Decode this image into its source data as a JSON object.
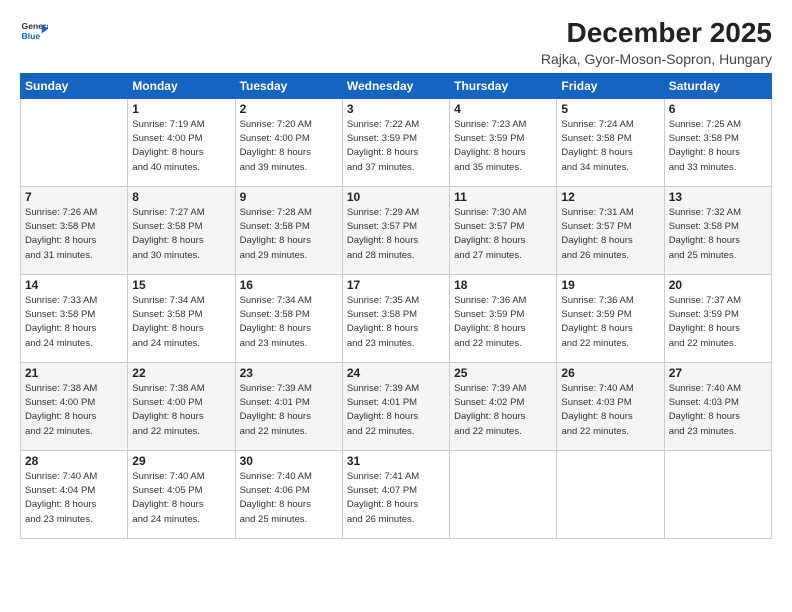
{
  "header": {
    "logo_line1": "General",
    "logo_line2": "Blue",
    "month": "December 2025",
    "location": "Rajka, Gyor-Moson-Sopron, Hungary"
  },
  "weekdays": [
    "Sunday",
    "Monday",
    "Tuesday",
    "Wednesday",
    "Thursday",
    "Friday",
    "Saturday"
  ],
  "weeks": [
    [
      {
        "day": "",
        "info": ""
      },
      {
        "day": "1",
        "info": "Sunrise: 7:19 AM\nSunset: 4:00 PM\nDaylight: 8 hours\nand 40 minutes."
      },
      {
        "day": "2",
        "info": "Sunrise: 7:20 AM\nSunset: 4:00 PM\nDaylight: 8 hours\nand 39 minutes."
      },
      {
        "day": "3",
        "info": "Sunrise: 7:22 AM\nSunset: 3:59 PM\nDaylight: 8 hours\nand 37 minutes."
      },
      {
        "day": "4",
        "info": "Sunrise: 7:23 AM\nSunset: 3:59 PM\nDaylight: 8 hours\nand 35 minutes."
      },
      {
        "day": "5",
        "info": "Sunrise: 7:24 AM\nSunset: 3:58 PM\nDaylight: 8 hours\nand 34 minutes."
      },
      {
        "day": "6",
        "info": "Sunrise: 7:25 AM\nSunset: 3:58 PM\nDaylight: 8 hours\nand 33 minutes."
      }
    ],
    [
      {
        "day": "7",
        "info": "Sunrise: 7:26 AM\nSunset: 3:58 PM\nDaylight: 8 hours\nand 31 minutes."
      },
      {
        "day": "8",
        "info": "Sunrise: 7:27 AM\nSunset: 3:58 PM\nDaylight: 8 hours\nand 30 minutes."
      },
      {
        "day": "9",
        "info": "Sunrise: 7:28 AM\nSunset: 3:58 PM\nDaylight: 8 hours\nand 29 minutes."
      },
      {
        "day": "10",
        "info": "Sunrise: 7:29 AM\nSunset: 3:57 PM\nDaylight: 8 hours\nand 28 minutes."
      },
      {
        "day": "11",
        "info": "Sunrise: 7:30 AM\nSunset: 3:57 PM\nDaylight: 8 hours\nand 27 minutes."
      },
      {
        "day": "12",
        "info": "Sunrise: 7:31 AM\nSunset: 3:57 PM\nDaylight: 8 hours\nand 26 minutes."
      },
      {
        "day": "13",
        "info": "Sunrise: 7:32 AM\nSunset: 3:58 PM\nDaylight: 8 hours\nand 25 minutes."
      }
    ],
    [
      {
        "day": "14",
        "info": "Sunrise: 7:33 AM\nSunset: 3:58 PM\nDaylight: 8 hours\nand 24 minutes."
      },
      {
        "day": "15",
        "info": "Sunrise: 7:34 AM\nSunset: 3:58 PM\nDaylight: 8 hours\nand 24 minutes."
      },
      {
        "day": "16",
        "info": "Sunrise: 7:34 AM\nSunset: 3:58 PM\nDaylight: 8 hours\nand 23 minutes."
      },
      {
        "day": "17",
        "info": "Sunrise: 7:35 AM\nSunset: 3:58 PM\nDaylight: 8 hours\nand 23 minutes."
      },
      {
        "day": "18",
        "info": "Sunrise: 7:36 AM\nSunset: 3:59 PM\nDaylight: 8 hours\nand 22 minutes."
      },
      {
        "day": "19",
        "info": "Sunrise: 7:36 AM\nSunset: 3:59 PM\nDaylight: 8 hours\nand 22 minutes."
      },
      {
        "day": "20",
        "info": "Sunrise: 7:37 AM\nSunset: 3:59 PM\nDaylight: 8 hours\nand 22 minutes."
      }
    ],
    [
      {
        "day": "21",
        "info": "Sunrise: 7:38 AM\nSunset: 4:00 PM\nDaylight: 8 hours\nand 22 minutes."
      },
      {
        "day": "22",
        "info": "Sunrise: 7:38 AM\nSunset: 4:00 PM\nDaylight: 8 hours\nand 22 minutes."
      },
      {
        "day": "23",
        "info": "Sunrise: 7:39 AM\nSunset: 4:01 PM\nDaylight: 8 hours\nand 22 minutes."
      },
      {
        "day": "24",
        "info": "Sunrise: 7:39 AM\nSunset: 4:01 PM\nDaylight: 8 hours\nand 22 minutes."
      },
      {
        "day": "25",
        "info": "Sunrise: 7:39 AM\nSunset: 4:02 PM\nDaylight: 8 hours\nand 22 minutes."
      },
      {
        "day": "26",
        "info": "Sunrise: 7:40 AM\nSunset: 4:03 PM\nDaylight: 8 hours\nand 22 minutes."
      },
      {
        "day": "27",
        "info": "Sunrise: 7:40 AM\nSunset: 4:03 PM\nDaylight: 8 hours\nand 23 minutes."
      }
    ],
    [
      {
        "day": "28",
        "info": "Sunrise: 7:40 AM\nSunset: 4:04 PM\nDaylight: 8 hours\nand 23 minutes."
      },
      {
        "day": "29",
        "info": "Sunrise: 7:40 AM\nSunset: 4:05 PM\nDaylight: 8 hours\nand 24 minutes."
      },
      {
        "day": "30",
        "info": "Sunrise: 7:40 AM\nSunset: 4:06 PM\nDaylight: 8 hours\nand 25 minutes."
      },
      {
        "day": "31",
        "info": "Sunrise: 7:41 AM\nSunset: 4:07 PM\nDaylight: 8 hours\nand 26 minutes."
      },
      {
        "day": "",
        "info": ""
      },
      {
        "day": "",
        "info": ""
      },
      {
        "day": "",
        "info": ""
      }
    ]
  ]
}
